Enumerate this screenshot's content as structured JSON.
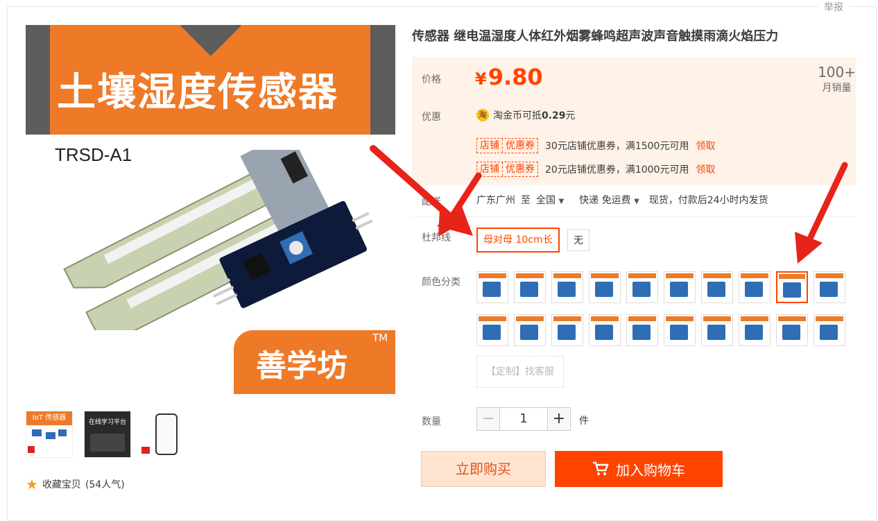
{
  "report_label": "举报",
  "main_image": {
    "title": "土壤湿度传感器",
    "model": "TRSD-A1",
    "brand": "善学坊",
    "tm": "TM"
  },
  "thumbnails": [
    {
      "caption": "IoT 传感器"
    },
    {
      "caption": "在线学习平台"
    },
    {
      "caption": ""
    }
  ],
  "favorite": {
    "label": "收藏宝贝",
    "count": "(54人气)"
  },
  "product": {
    "title": "传感器 继电温湿度人体红外烟雾蜂鸣超声波声音触摸雨滴火焰压力"
  },
  "price": {
    "label": "价格",
    "currency": "¥",
    "value": "9.80",
    "sales_count": "100+",
    "sales_label": "月销量"
  },
  "promo": {
    "label": "优惠",
    "coin_icon": "淘",
    "coin_text": "淘金币可抵",
    "coin_value": "0.29",
    "coin_unit": "元",
    "coupons": [
      {
        "tag_a": "店铺",
        "tag_b": "优惠券",
        "text": "30元店铺优惠券，满1500元可用",
        "action": "领取"
      },
      {
        "tag_a": "店铺",
        "tag_b": "优惠券",
        "text": "20元店铺优惠券，满1000元可用",
        "action": "领取"
      }
    ]
  },
  "delivery": {
    "label": "配送",
    "from": "广东广州",
    "to_word": "至",
    "to": "全国",
    "method": "快递 免运费",
    "note": "现货，付款后24小时内发货"
  },
  "dupont": {
    "label": "杜邦线",
    "options": [
      "母对母 10cm长",
      "无"
    ],
    "selected": 0
  },
  "color": {
    "label": "颜色分类",
    "selected_index": 8,
    "custom_label": "【定制】找客服"
  },
  "quantity": {
    "label": "数量",
    "value": "1",
    "unit": "件",
    "minus": "−",
    "plus": "+"
  },
  "actions": {
    "buy_now": "立即购买",
    "add_cart": "加入购物车"
  },
  "colors": {
    "accent": "#ff4400",
    "brand_orange": "#ee7a28",
    "price_bg": "#fff2e8"
  }
}
